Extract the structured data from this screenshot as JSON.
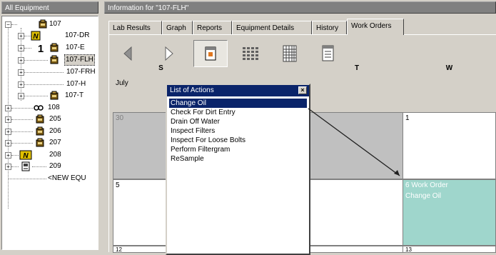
{
  "left_pane": {
    "header": "All Equipment",
    "tree": [
      {
        "label": "107",
        "icon": "truck-icon",
        "level": 1,
        "expanded": true
      },
      {
        "label": "107-DR",
        "icon": "n-badge-icon",
        "level": 2
      },
      {
        "label": "107-E",
        "icon": "one-badge-icon",
        "level": 2
      },
      {
        "label": "107-FLH",
        "icon": "truck-icon",
        "level": 2,
        "selected": true
      },
      {
        "label": "107-FRH",
        "icon": "",
        "level": 2
      },
      {
        "label": "107-H",
        "icon": "",
        "level": 2
      },
      {
        "label": "107-T",
        "icon": "truck-icon",
        "level": 2
      },
      {
        "label": "108",
        "icon": "wheel-icon",
        "level": 1
      },
      {
        "label": "205",
        "icon": "truck-icon",
        "level": 1
      },
      {
        "label": "206",
        "icon": "truck-icon",
        "level": 1
      },
      {
        "label": "207",
        "icon": "truck-icon",
        "level": 1
      },
      {
        "label": "208",
        "icon": "n-badge-icon",
        "level": 1
      },
      {
        "label": "209",
        "icon": "generator-icon",
        "level": 1
      },
      {
        "label": "<NEW EQU",
        "icon": "",
        "level": 1
      }
    ]
  },
  "right_pane": {
    "header": "Information for \"107-FLH\"",
    "tabs": [
      "Lab Results",
      "Graph",
      "Reports",
      "Equipment Details",
      "History",
      "Work Orders"
    ],
    "active_tab": "Work Orders",
    "toolbar": [
      "prev-arrow-icon",
      "next-arrow-icon",
      "day-view-icon",
      "week-view-icon",
      "month-view-icon",
      "notes-icon"
    ],
    "month": "July",
    "day_headers": {
      "s": "S",
      "t": "T",
      "w": "W"
    },
    "cells": {
      "r1_first": "30",
      "r1_last": "1",
      "r2_first": "5",
      "r2_last_line1": "6 Work Order",
      "r2_last_line2": "Change Oil",
      "r3_first": "12",
      "r3_last": "13"
    }
  },
  "actions_popup": {
    "title": "List of Actions",
    "items": [
      "Change Oil",
      "Check For Dirt Entry",
      "Drain Off Water",
      "Inspect Filters",
      "Inspect For Loose Bolts",
      "Perform Filtergram",
      "ReSample"
    ],
    "selected_index": 0
  },
  "colors": {
    "selection_blue": "#0a246a",
    "work_order_teal": "#9fd6cc"
  }
}
